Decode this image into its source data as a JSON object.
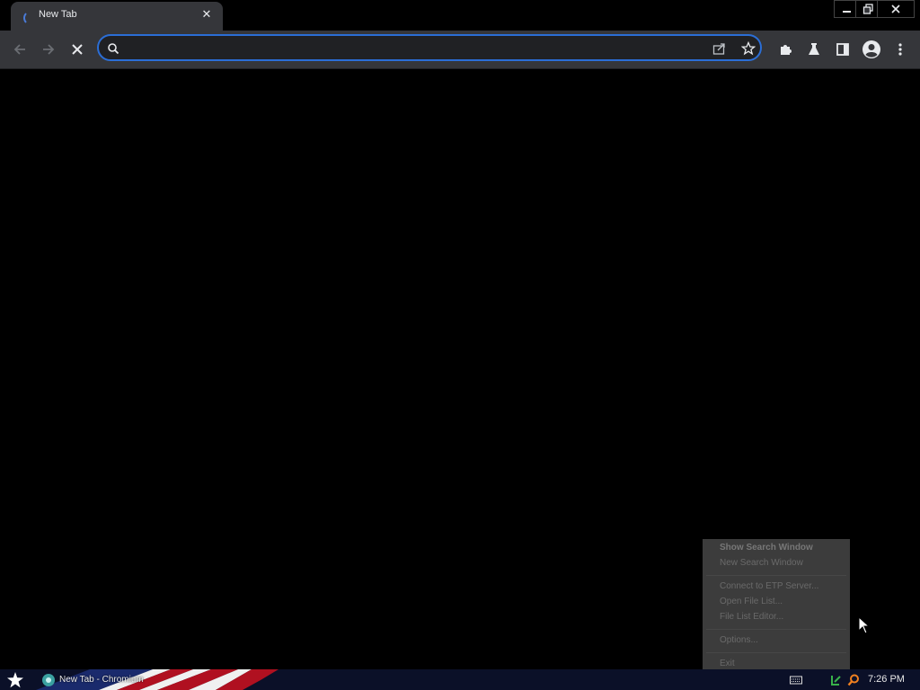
{
  "tab": {
    "title": "New Tab",
    "close_glyph": "✕"
  },
  "omnibox": {
    "value": "",
    "placeholder": ""
  },
  "context_menu": {
    "items": [
      {
        "label": "Show Search Window",
        "bold": true
      },
      {
        "label": "New Search Window"
      },
      {
        "label": "Connect to ETP Server..."
      },
      {
        "label": "Open File List..."
      },
      {
        "label": "File List Editor..."
      },
      {
        "label": "Options..."
      },
      {
        "label": "Exit"
      }
    ]
  },
  "taskbar": {
    "app_label": "New Tab - Chromium",
    "clock": "7:26 PM"
  },
  "colors": {
    "accent": "#2b6ed6",
    "toolbar": "#35363a",
    "taskbar": "#0b1028"
  },
  "icons": {
    "back": "arrow-left-icon",
    "forward": "arrow-right-icon",
    "stop": "close-icon",
    "search": "search-icon",
    "share": "share-icon",
    "bookmark": "star-icon",
    "extensions": "puzzle-icon",
    "labs": "flask-icon",
    "side_panel": "side-panel-icon",
    "profile": "profile-icon",
    "menu": "kebab-menu-icon"
  }
}
